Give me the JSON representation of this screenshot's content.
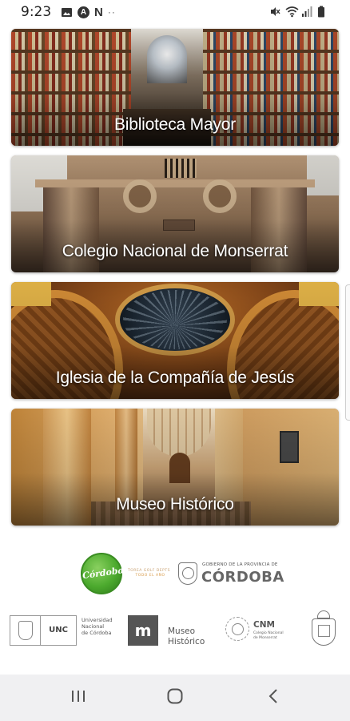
{
  "status_bar": {
    "time": "9:23",
    "left_icons": [
      "gallery-icon",
      "a-badge-icon",
      "n-icon",
      "more-dots-icon"
    ],
    "right_icons": [
      "mute-icon",
      "wifi-icon",
      "signal-icon",
      "battery-icon"
    ],
    "a_badge_text": "A",
    "n_text": "N",
    "dots_text": "··"
  },
  "cards": [
    {
      "title": "Biblioteca Mayor"
    },
    {
      "title": "Colegio Nacional de Monserrat"
    },
    {
      "title": "Iglesia de la Compañía de Jesús"
    },
    {
      "title": "Museo Histórico"
    }
  ],
  "logos": {
    "cordoba_tourism": {
      "mark_text": "Córdoba",
      "tagline_1": "TOREA GOLF DEPTS",
      "tagline_2": "TODO EL AÑO"
    },
    "gobierno": {
      "small_text": "GOBIERNO DE LA PROVINCIA DE",
      "big_text": "CÓRDOBA"
    },
    "unc": {
      "short": "UNC",
      "line1": "Universidad",
      "line2": "Nacional",
      "line3": "de Córdoba"
    },
    "museo_historico": {
      "mark": "m",
      "line1": "Museo",
      "line2": "Histórico"
    },
    "cnm": {
      "short": "CNM",
      "line1": "Colegio Nacional",
      "line2": "de Monserrat"
    }
  },
  "nav_bar": {
    "icons": [
      "recent-apps-icon",
      "home-icon",
      "back-icon"
    ]
  }
}
